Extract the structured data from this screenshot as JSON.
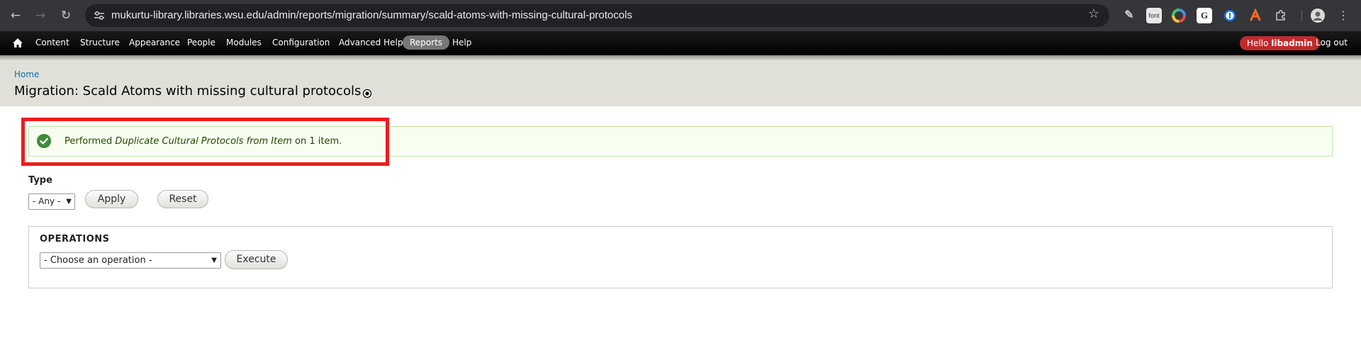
{
  "browser": {
    "url": "mukurtu-library.libraries.wsu.edu/admin/reports/migration/summary/scald-atoms-with-missing-cultural-protocols",
    "extensions": [
      {
        "icon": "eyedropper-icon"
      },
      {
        "icon": "font-icon",
        "label": "font"
      },
      {
        "icon": "color-wheel-icon"
      },
      {
        "icon": "google-icon",
        "label": "G"
      },
      {
        "icon": "onepassword-icon"
      },
      {
        "icon": "honey-icon"
      },
      {
        "icon": "puzzle-icon"
      },
      {
        "icon": "profile-avatar-icon"
      }
    ]
  },
  "toolbar": {
    "items": [
      "Content",
      "Structure",
      "Appearance",
      "People",
      "Modules",
      "Configuration",
      "Advanced Help",
      "Reports",
      "Help"
    ],
    "active": "Reports",
    "hello_prefix": "Hello ",
    "username": "libadmin",
    "logout": "Log out"
  },
  "header": {
    "breadcrumb": "Home",
    "title": "Migration: Scald Atoms with missing cultural protocols"
  },
  "message": {
    "prefix": "Performed ",
    "operation": "Duplicate Cultural Protocols from Item",
    "suffix": " on 1 item.",
    "status_color": "#234600"
  },
  "filter": {
    "type_label": "Type",
    "type_value": "- Any -",
    "apply_label": "Apply",
    "reset_label": "Reset"
  },
  "operations": {
    "legend": "OPERATIONS",
    "select_value": "- Choose an operation -",
    "execute_label": "Execute"
  },
  "colors": {
    "accent_red": "#bf2b2b",
    "highlight_red": "#ee1c1c",
    "link_blue": "#0074bd"
  }
}
